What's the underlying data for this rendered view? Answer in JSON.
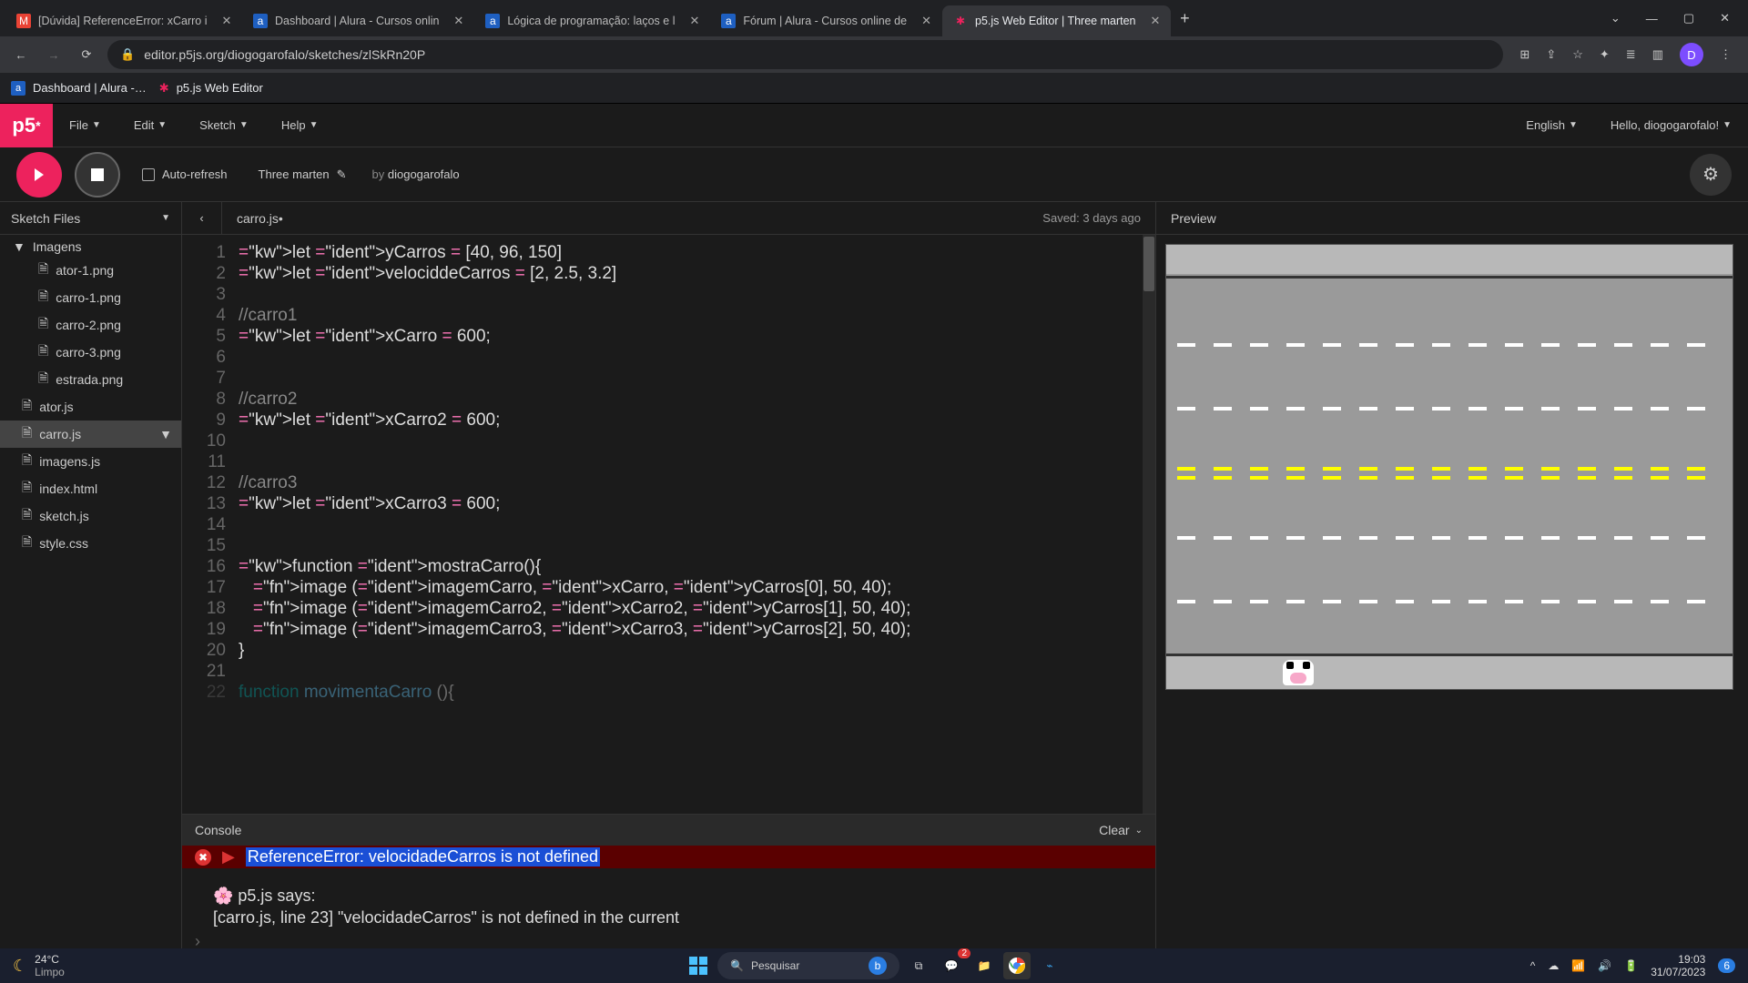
{
  "browser": {
    "tabs": [
      {
        "title": "[Dúvida] ReferenceError: xCarro i",
        "favicon": "M"
      },
      {
        "title": "Dashboard | Alura - Cursos onlin",
        "favicon": "a"
      },
      {
        "title": "Lógica de programação: laços e l",
        "favicon": "a"
      },
      {
        "title": "Fórum | Alura - Cursos online de",
        "favicon": "a"
      },
      {
        "title": "p5.js Web Editor | Three marten",
        "favicon": "✱",
        "active": true
      }
    ],
    "url": "editor.p5js.org/diogogarofalo/sketches/zlSkRn20P",
    "bookmarks": [
      {
        "label": "Dashboard | Alura -…",
        "favicon": "a"
      },
      {
        "label": "p5.js Web Editor",
        "favicon": "✱"
      }
    ],
    "avatar_letter": "D"
  },
  "editor": {
    "menubar": {
      "file": "File",
      "edit": "Edit",
      "sketch": "Sketch",
      "help": "Help",
      "language": "English",
      "greeting": "Hello, diogogarofalo!"
    },
    "toolbar": {
      "autorefresh": "Auto-refresh",
      "sketch_name": "Three marten",
      "by": "by",
      "author": "diogogarofalo"
    },
    "sidebar": {
      "title": "Sketch Files",
      "folder": "Imagens",
      "folder_children": [
        "ator-1.png",
        "carro-1.png",
        "carro-2.png",
        "carro-3.png",
        "estrada.png"
      ],
      "files": [
        "ator.js",
        "carro.js",
        "imagens.js",
        "index.html",
        "sketch.js",
        "style.css"
      ],
      "selected": "carro.js"
    },
    "tab": {
      "filename": "carro.js",
      "modified": "•",
      "saved": "Saved: 3 days ago"
    },
    "code_lines": [
      "let yCarros = [40, 96, 150]",
      "let velociddeCarros = [2, 2.5, 3.2]",
      "",
      "//carro1",
      "let xCarro = 600;",
      "",
      "",
      "//carro2",
      "let xCarro2 = 600;",
      "",
      "",
      "//carro3",
      "let xCarro3 = 600;",
      "",
      "",
      "function mostraCarro(){",
      "   image (imagemCarro, xCarro, yCarros[0], 50, 40);",
      "   image (imagemCarro2, xCarro2, yCarros[1], 50, 40);",
      "   image (imagemCarro3, xCarro3, yCarros[2], 50, 40);",
      "}",
      ""
    ],
    "console": {
      "title": "Console",
      "clear": "Clear",
      "error": "ReferenceError: velocidadeCarros is not defined",
      "hint_prefix": "🌸 p5.js says:",
      "hint_body": "[carro.js, line 23] \"velocidadeCarros\" is not defined in the current"
    },
    "preview": {
      "title": "Preview"
    }
  },
  "taskbar": {
    "temp": "24°C",
    "weather": "Limpo",
    "search_placeholder": "Pesquisar",
    "time": "19:03",
    "date": "31/07/2023",
    "notif_count": "6",
    "chat_badge": "2"
  }
}
